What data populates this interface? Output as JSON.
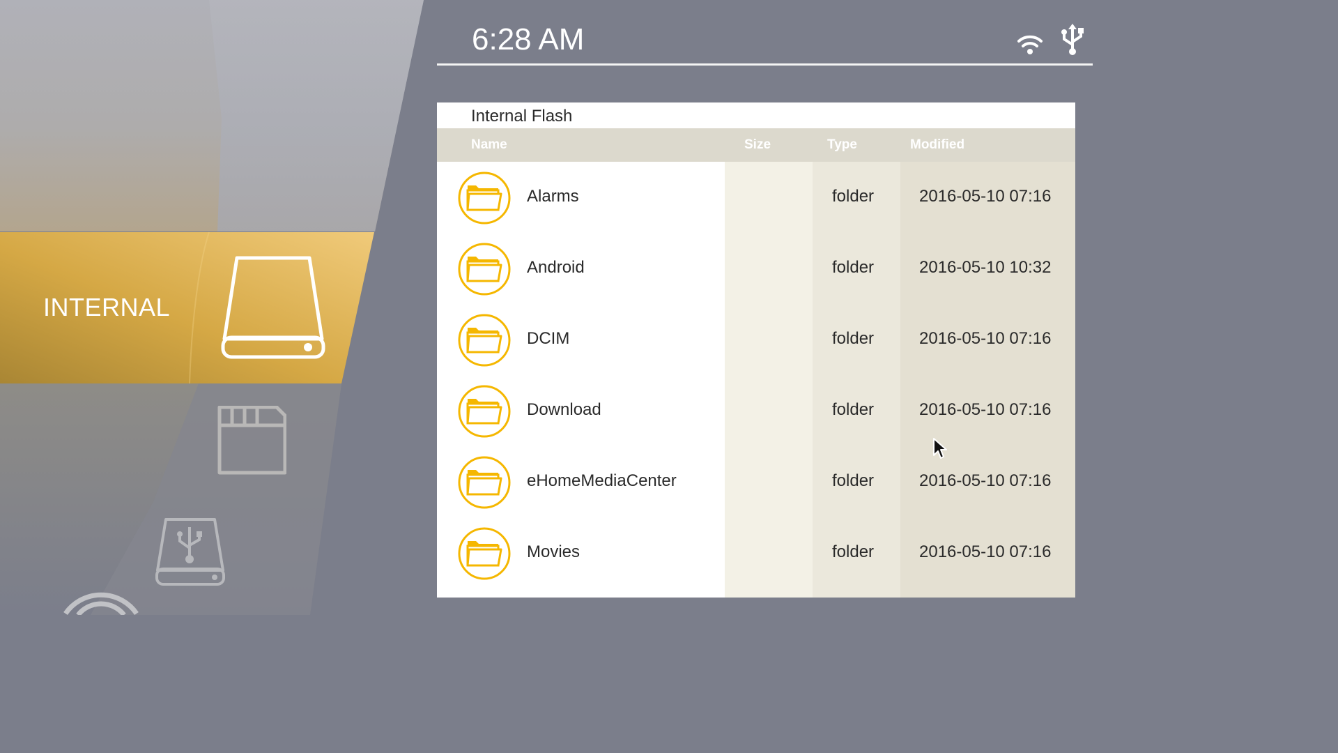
{
  "status_bar": {
    "time": "6:28 AM",
    "wifi_icon": "wifi-icon",
    "usb_icon": "usb-icon"
  },
  "sidebar": {
    "selected": "INTERNAL",
    "items": [
      {
        "id": "internal",
        "label": "INTERNAL",
        "icon": "hard-drive-icon",
        "selected": true
      },
      {
        "id": "sd-card",
        "label": "",
        "icon": "sd-card-icon",
        "selected": false
      },
      {
        "id": "usb-drive",
        "label": "",
        "icon": "usb-drive-icon",
        "selected": false
      },
      {
        "id": "network",
        "label": "",
        "icon": "network-icon",
        "selected": false
      }
    ],
    "accent_color": "#d9a940"
  },
  "file_panel": {
    "title": "Internal Flash",
    "columns": [
      "Name",
      "Size",
      "Type",
      "Modified"
    ],
    "rows": [
      {
        "name": "Alarms",
        "size": "",
        "type": "folder",
        "modified": "2016-05-10 07:16",
        "icon": "folder-icon"
      },
      {
        "name": "Android",
        "size": "",
        "type": "folder",
        "modified": "2016-05-10 10:32",
        "icon": "folder-icon"
      },
      {
        "name": "DCIM",
        "size": "",
        "type": "folder",
        "modified": "2016-05-10 07:16",
        "icon": "folder-icon"
      },
      {
        "name": "Download",
        "size": "",
        "type": "folder",
        "modified": "2016-05-10 07:16",
        "icon": "folder-icon"
      },
      {
        "name": "eHomeMediaCenter",
        "size": "",
        "type": "folder",
        "modified": "2016-05-10 07:16",
        "icon": "folder-icon"
      },
      {
        "name": "Movies",
        "size": "",
        "type": "folder",
        "modified": "2016-05-10 07:16",
        "icon": "folder-icon"
      }
    ]
  },
  "colors": {
    "background": "#7b7e8b",
    "folder_accent": "#f5b700",
    "header_row": "#dcd9cd"
  }
}
